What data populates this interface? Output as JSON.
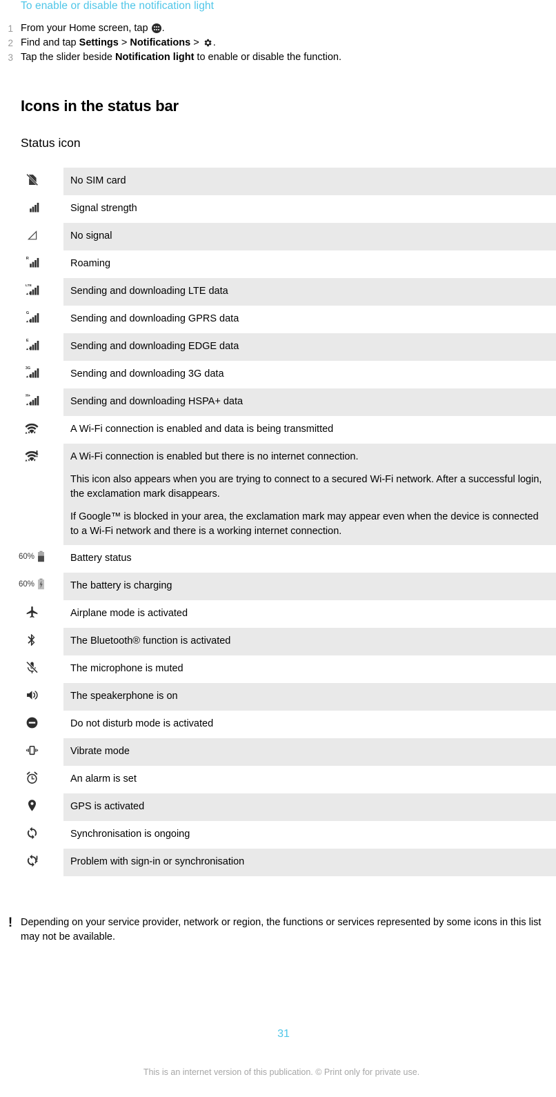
{
  "procedure": {
    "title": "To enable or disable the notification light",
    "steps": [
      {
        "num": "1",
        "pre": "From your Home screen, tap ",
        "icon": "app-drawer-icon",
        "post": "."
      },
      {
        "num": "2",
        "pre": "Find and tap ",
        "bold1": "Settings",
        "mid": " > ",
        "bold2": "Notifications",
        "mid2": " > ",
        "icon": "gear-icon",
        "post": "."
      },
      {
        "num": "3",
        "pre": "Tap the slider beside ",
        "bold1": "Notification light",
        "post": " to enable or disable the function."
      }
    ]
  },
  "section": {
    "heading": "Icons in the status bar",
    "subheading": "Status icon"
  },
  "icon_table": {
    "rows": [
      {
        "icon": "no-sim-card-icon",
        "shaded": true,
        "text": "No SIM card"
      },
      {
        "icon": "signal-strength-icon",
        "shaded": false,
        "text": "Signal strength"
      },
      {
        "icon": "no-signal-icon",
        "shaded": true,
        "text": "No signal"
      },
      {
        "icon": "roaming-icon",
        "shaded": false,
        "text": "Roaming",
        "badge": "R"
      },
      {
        "icon": "lte-data-icon",
        "shaded": true,
        "text": "Sending and downloading LTE data",
        "badge": "LTE"
      },
      {
        "icon": "gprs-data-icon",
        "shaded": false,
        "text": "Sending and downloading GPRS data",
        "badge": "G"
      },
      {
        "icon": "edge-data-icon",
        "shaded": true,
        "text": "Sending and downloading EDGE data",
        "badge": "E"
      },
      {
        "icon": "three-g-data-icon",
        "shaded": false,
        "text": "Sending and downloading 3G data",
        "badge": "3G"
      },
      {
        "icon": "hspa-plus-data-icon",
        "shaded": true,
        "text": "Sending and downloading HSPA+ data",
        "badge": "H+"
      },
      {
        "icon": "wifi-connected-icon",
        "shaded": false,
        "text": "A Wi-Fi connection is enabled and data is being transmitted"
      },
      {
        "icon": "wifi-no-internet-icon",
        "shaded": true,
        "paragraphs": [
          "A Wi-Fi connection is enabled but there is no internet connection.",
          "This icon also appears when you are trying to connect to a secured Wi-Fi network. After a successful login, the exclamation mark disappears.",
          "If Google™ is blocked in your area, the exclamation mark may appear even when the device is connected to a Wi-Fi network and there is a working internet connection."
        ]
      },
      {
        "icon": "battery-status-icon",
        "shaded": false,
        "text": "Battery status",
        "battery_label": "60%"
      },
      {
        "icon": "battery-charging-icon",
        "shaded": true,
        "text": "The battery is charging",
        "battery_label": "60%"
      },
      {
        "icon": "airplane-mode-icon",
        "shaded": false,
        "text": "Airplane mode is activated"
      },
      {
        "icon": "bluetooth-icon",
        "shaded": true,
        "text": "The Bluetooth® function is activated"
      },
      {
        "icon": "microphone-muted-icon",
        "shaded": false,
        "text": "The microphone is muted"
      },
      {
        "icon": "speakerphone-icon",
        "shaded": true,
        "text": "The speakerphone is on"
      },
      {
        "icon": "do-not-disturb-icon",
        "shaded": false,
        "text": "Do not disturb mode is activated"
      },
      {
        "icon": "vibrate-mode-icon",
        "shaded": true,
        "text": "Vibrate mode"
      },
      {
        "icon": "alarm-clock-icon",
        "shaded": false,
        "text": "An alarm is set"
      },
      {
        "icon": "gps-location-icon",
        "shaded": true,
        "text": "GPS is activated"
      },
      {
        "icon": "sync-icon",
        "shaded": false,
        "text": "Synchronisation is ongoing"
      },
      {
        "icon": "sync-problem-icon",
        "shaded": true,
        "text": "Problem with sign-in or synchronisation"
      }
    ]
  },
  "note": {
    "icon": "exclamation-icon",
    "text": "Depending on your service provider, network or region, the functions or services represented by some icons in this list may not be available."
  },
  "footer": {
    "page_number": "31",
    "disclaimer": "This is an internet version of this publication. © Print only for private use."
  },
  "colors": {
    "accent": "#4FC6E8",
    "row_shade": "#e9e9e9",
    "step_number": "#9a9a9a",
    "footer_text": "#a6a6a6"
  }
}
